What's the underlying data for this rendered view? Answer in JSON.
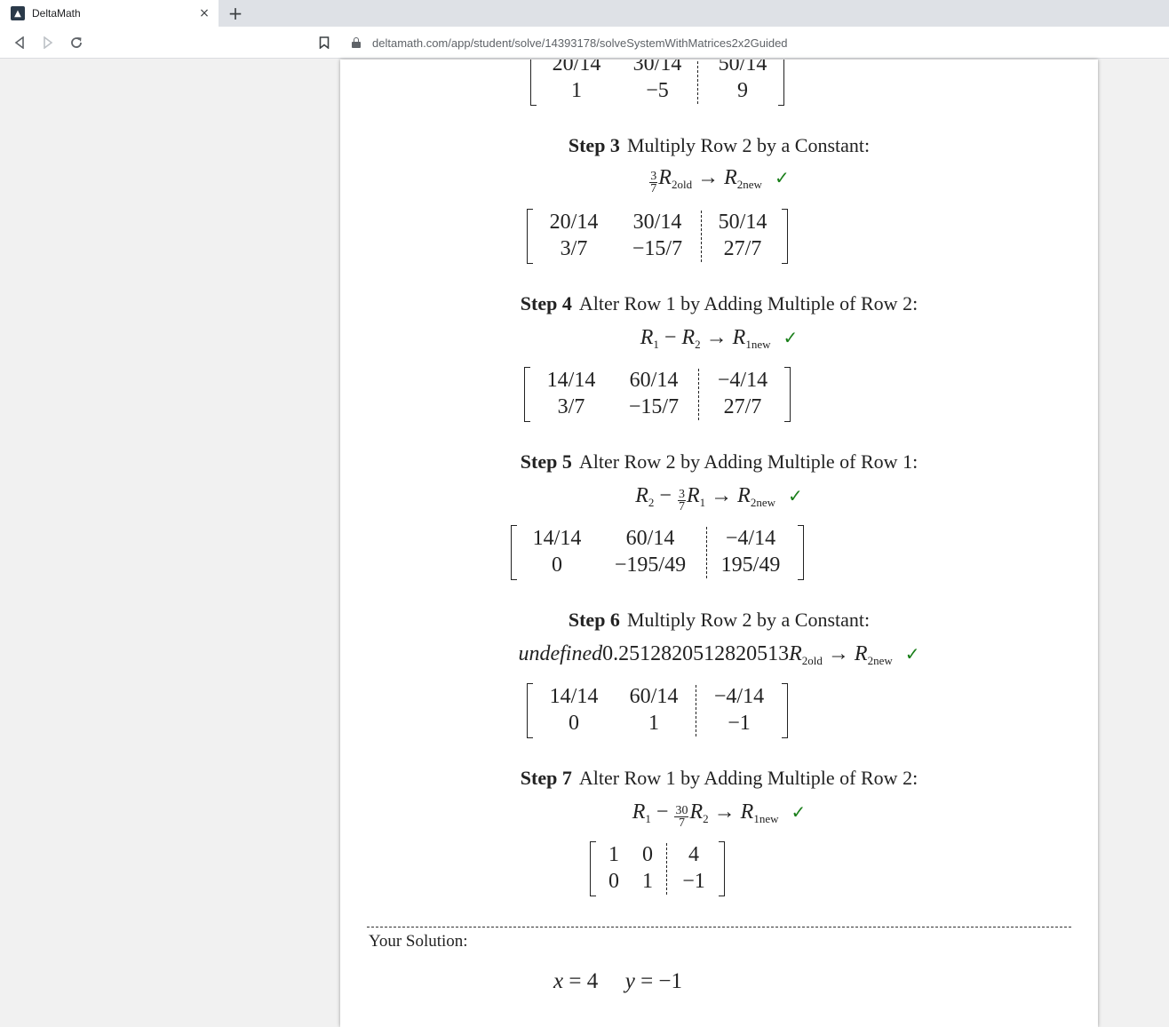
{
  "browser": {
    "tab_title": "DeltaMath",
    "tab_close": "×",
    "new_tab": "+",
    "url": "deltamath.com/app/student/solve/14393178/solveSystemWithMatrices2x2Guided"
  },
  "matrix_top": {
    "rows": [
      [
        "20/14",
        "30/14",
        "50/14"
      ],
      [
        "1",
        "−5",
        "9"
      ]
    ]
  },
  "steps": [
    {
      "label": "Step 3",
      "title": "Multiply Row 2 by a Constant:",
      "op": {
        "frac_num": "3",
        "frac_den": "7",
        "lhs": "R",
        "lhs_sub": "2",
        "lhs_subsub": "old",
        "arrow": "→",
        "rhs": "R",
        "rhs_sub": "2",
        "rhs_subsub": "new"
      },
      "check": "✓",
      "matrix": [
        [
          "20/14",
          "30/14",
          "50/14"
        ],
        [
          "3/7",
          "−15/7",
          "27/7"
        ]
      ]
    },
    {
      "label": "Step 4",
      "title": "Alter Row 1 by Adding Multiple of Row 2:",
      "op": {
        "a": "R",
        "a_sub": "1",
        "minus": "−",
        "b": "R",
        "b_sub": "2",
        "arrow": "→",
        "rhs": "R",
        "rhs_sub": "1",
        "rhs_subsub": "new"
      },
      "check": "✓",
      "matrix": [
        [
          "14/14",
          "60/14",
          "−4/14"
        ],
        [
          "3/7",
          "−15/7",
          "27/7"
        ]
      ]
    },
    {
      "label": "Step 5",
      "title": "Alter Row 2 by Adding Multiple of Row 1:",
      "op": {
        "a": "R",
        "a_sub": "2",
        "minus": "−",
        "frac_num": "3",
        "frac_den": "7",
        "b": "R",
        "b_sub": "1",
        "arrow": "→",
        "rhs": "R",
        "rhs_sub": "2",
        "rhs_subsub": "new"
      },
      "check": "✓",
      "matrix": [
        [
          "14/14",
          "60/14",
          "−4/14"
        ],
        [
          "0",
          "−195/49",
          "195/49"
        ]
      ]
    },
    {
      "label": "Step 6",
      "title": "Multiply Row 2 by a Constant:",
      "op": {
        "prefix": "undefined",
        "constant": "0.2512820512820513",
        "lhs": "R",
        "lhs_sub": "2",
        "lhs_subsub": "old",
        "arrow": "→",
        "rhs": "R",
        "rhs_sub": "2",
        "rhs_subsub": "new"
      },
      "check": "✓",
      "matrix": [
        [
          "14/14",
          "60/14",
          "−4/14"
        ],
        [
          "0",
          "1",
          "−1"
        ]
      ]
    },
    {
      "label": "Step 7",
      "title": "Alter Row 1 by Adding Multiple of Row 2:",
      "op": {
        "a": "R",
        "a_sub": "1",
        "minus": "−",
        "frac_num": "30",
        "frac_den": "7",
        "b": "R",
        "b_sub": "2",
        "arrow": "→",
        "rhs": "R",
        "rhs_sub": "1",
        "rhs_subsub": "new"
      },
      "check": "✓",
      "matrix": [
        [
          "1",
          "0",
          "4"
        ],
        [
          "0",
          "1",
          "−1"
        ]
      ]
    }
  ],
  "solution": {
    "label": "Your Solution:",
    "x_var": "x",
    "x_eq": "= 4",
    "y_var": "y",
    "y_eq": "= −1"
  },
  "colors": {
    "check": "#1a7f1a",
    "page_bg": "#f1f1f1"
  }
}
